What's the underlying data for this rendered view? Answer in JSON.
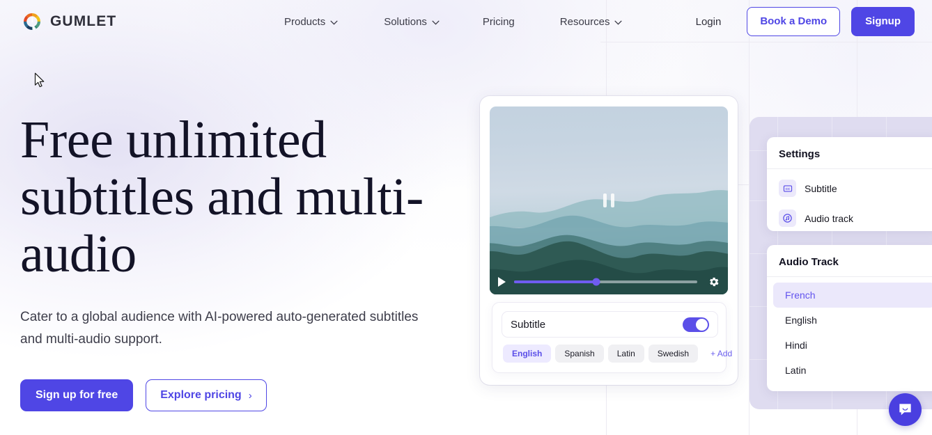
{
  "header": {
    "brand": "GUMLET",
    "nav": [
      {
        "label": "Products",
        "has_caret": true
      },
      {
        "label": "Solutions",
        "has_caret": true
      },
      {
        "label": "Pricing",
        "has_caret": false
      },
      {
        "label": "Resources",
        "has_caret": true
      }
    ],
    "login_label": "Login",
    "demo_label": "Book a Demo",
    "signup_label": "Signup"
  },
  "hero": {
    "heading": "Free unlimited subtitles and multi-audio",
    "subheading": "Cater to a global audience with AI-powered auto-generated subtitles and multi-audio support.",
    "primary_cta": "Sign up for free",
    "secondary_cta": "Explore pricing",
    "secondary_cta_arrow": "›"
  },
  "player": {
    "state": "paused",
    "progress_percent": 45,
    "play_icon": "play-icon",
    "settings_icon": "gear-icon",
    "pause_overlay_icon": "pause-icon"
  },
  "subtitle_panel": {
    "row_label": "Subtitle",
    "toggle_on": true,
    "languages": [
      {
        "label": "English",
        "selected": true
      },
      {
        "label": "Spanish",
        "selected": false
      },
      {
        "label": "Latin",
        "selected": false
      },
      {
        "label": "Swedish",
        "selected": false
      }
    ],
    "add_label": "+ Add"
  },
  "settings_card": {
    "title": "Settings",
    "items": [
      {
        "label": "Subtitle",
        "icon": "closed-caption-icon"
      },
      {
        "label": "Audio track",
        "icon": "music-note-icon"
      }
    ]
  },
  "audio_track_card": {
    "title": "Audio Track",
    "tracks": [
      {
        "label": "French",
        "selected": true
      },
      {
        "label": "English",
        "selected": false
      },
      {
        "label": "Hindi",
        "selected": false
      },
      {
        "label": "Latin",
        "selected": false
      }
    ]
  },
  "chat_widget": {
    "icon": "chat-bubble-icon"
  },
  "colors": {
    "brand_purple": "#4F46E5",
    "accent_purple": "#5B4FE8",
    "chip_active_bg": "#EDEAFF",
    "heading": "#131327",
    "lavender_panel": "#DFDCF0",
    "chat_fab": "#4A3FE0"
  }
}
